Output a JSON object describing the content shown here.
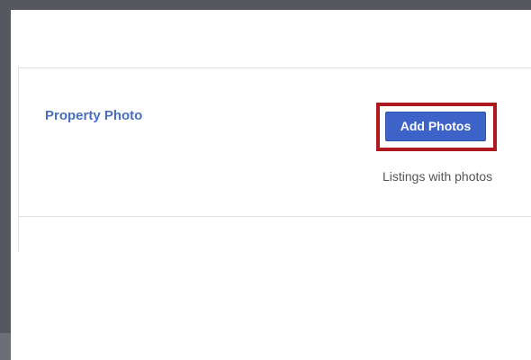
{
  "property_photo": {
    "title": "Property Photo",
    "add_button_label": "Add Photos",
    "helper_text": "Listings with photos"
  },
  "colors": {
    "title": "#4a6fbd",
    "button_bg": "#3d63c8",
    "highlight_border": "#b0181f",
    "frame": "#55585e"
  }
}
